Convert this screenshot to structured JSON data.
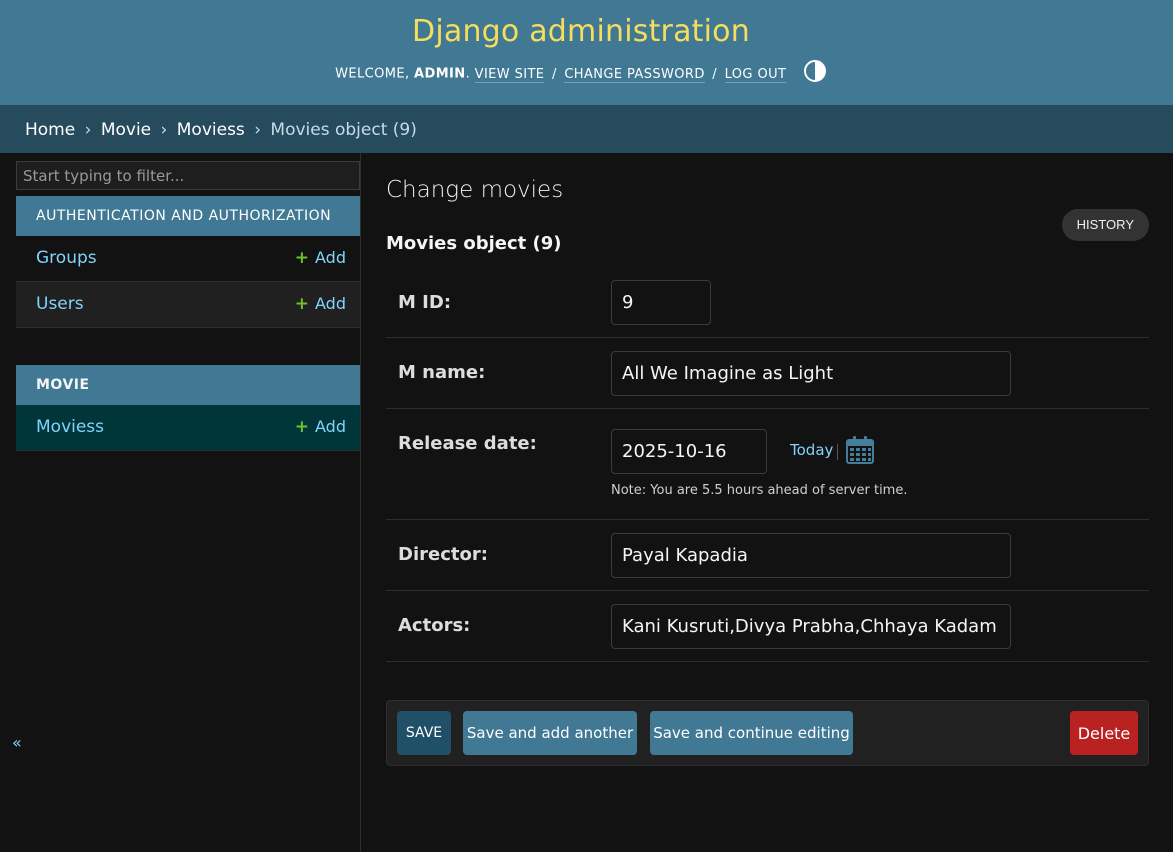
{
  "header": {
    "site_title": "Django administration",
    "welcome": "Welcome,",
    "username": "admin",
    "view_site": "View site",
    "change_password": "Change password",
    "log_out": "Log out",
    "separator": "/",
    "theme_toggle_icon": "half-circle-icon"
  },
  "breadcrumbs": {
    "items": [
      "Home",
      "Movie",
      "Moviess",
      "Movies object (9)"
    ],
    "separator": "›"
  },
  "sidebar": {
    "filter_placeholder": "Start typing to filter...",
    "collapse_label": "«",
    "modules": [
      {
        "caption": "Authentication and Authorization",
        "models": [
          {
            "name": "Groups",
            "add_label": "Add"
          },
          {
            "name": "Users",
            "add_label": "Add"
          }
        ]
      },
      {
        "caption": "Movie",
        "models": [
          {
            "name": "Moviess",
            "add_label": "Add",
            "current": true
          }
        ]
      }
    ],
    "add_icon": "+"
  },
  "content": {
    "title": "Change movies",
    "history_label": "History",
    "object_title": "Movies object (9)",
    "fields": {
      "m_id": {
        "label": "M ID:",
        "value": "9"
      },
      "m_name": {
        "label": "M name:",
        "value": "All We Imagine as Light"
      },
      "release_date": {
        "label": "Release date:",
        "value": "2025-10-16",
        "today_label": "Today",
        "help_text": "Note: You are 5.5 hours ahead of server time."
      },
      "director": {
        "label": "Director:",
        "value": "Payal Kapadia"
      },
      "actors": {
        "label": "Actors:",
        "value": "Kani Kusruti,Divya Prabha,Chhaya Kadam"
      }
    },
    "buttons": {
      "save": "Save",
      "save_add_another": "Save and add another",
      "save_continue": "Save and continue editing",
      "delete": "Delete"
    }
  },
  "colors": {
    "header_bg": "#417893",
    "breadcrumb_bg": "#264b5d",
    "site_title": "#f5dd5d",
    "link": "#81d4fa",
    "add_plus": "#70bf2b",
    "delete": "#ba2121",
    "save": "#205067"
  }
}
